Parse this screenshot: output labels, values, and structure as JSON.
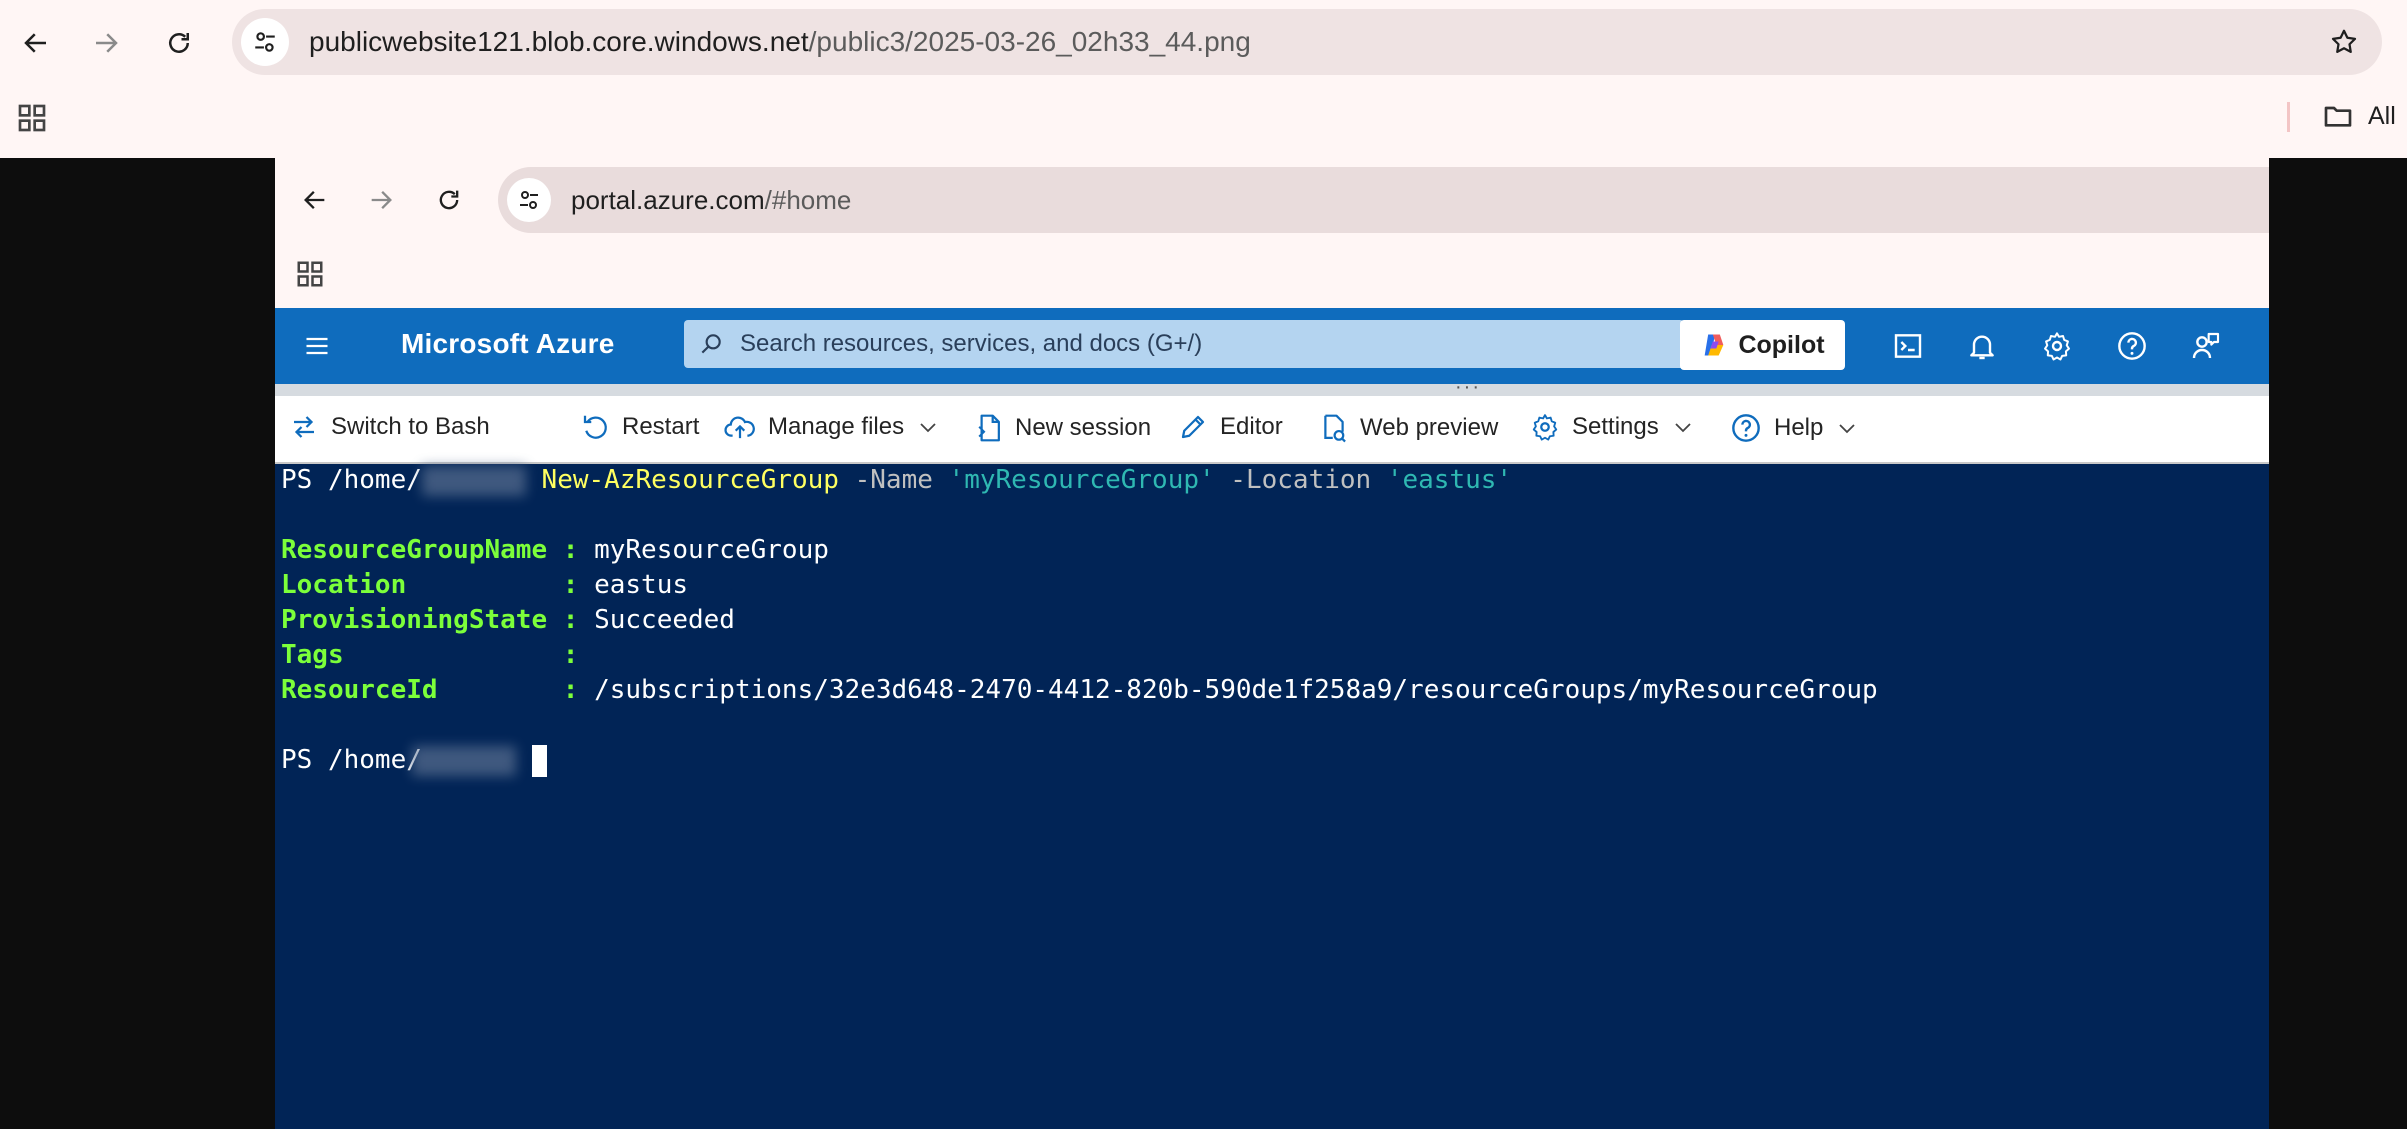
{
  "outer_browser": {
    "url_host": "publicwebsite121.blob.core.windows.net",
    "url_path": "/public3/2025-03-26_02h33_44.png",
    "bookmarks_label": "All"
  },
  "inner_browser": {
    "url_host": "portal.azure.com",
    "url_path": "/#home"
  },
  "azure": {
    "brand": "Microsoft Azure",
    "search_placeholder": "Search resources, services, and docs (G+/)",
    "copilot_label": "Copilot"
  },
  "shell_toolbar": {
    "switch": "Switch to Bash",
    "restart": "Restart",
    "manage_files": "Manage files",
    "new_session": "New session",
    "editor": "Editor",
    "web_preview": "Web preview",
    "settings": "Settings",
    "help": "Help"
  },
  "terminal": {
    "prompt1": "PS /home/",
    "cmdlet": "New-AzResourceGroup",
    "param_name": " -Name ",
    "value_name": "'myResourceGroup'",
    "param_location": " -Location ",
    "value_location": "'eastus'",
    "output": [
      {
        "key": "ResourceGroupName",
        "sep": " : ",
        "value": "myResourceGroup"
      },
      {
        "key": "Location         ",
        "sep": " : ",
        "value": "eastus"
      },
      {
        "key": "ProvisioningState",
        "sep": " : ",
        "value": "Succeeded"
      },
      {
        "key": "Tags             ",
        "sep": " : ",
        "value": ""
      },
      {
        "key": "ResourceId       ",
        "sep": " : ",
        "value": "/subscriptions/32e3d648-2470-4412-820b-590de1f258a9/resourceGroups/myResourceGroup"
      }
    ],
    "prompt2": "PS /home/"
  }
}
